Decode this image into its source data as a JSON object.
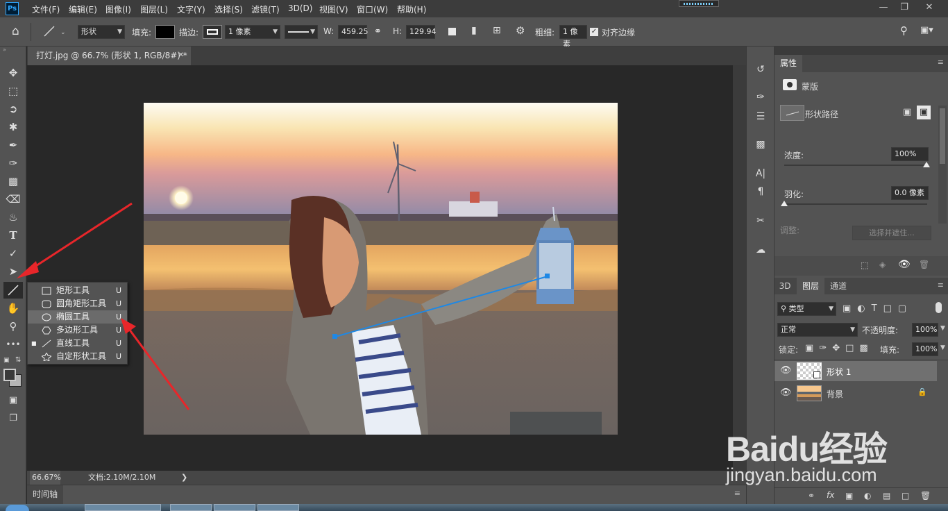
{
  "app": {
    "logo": "Ps"
  },
  "menu": [
    "文件(F)",
    "编辑(E)",
    "图像(I)",
    "图层(L)",
    "文字(Y)",
    "选择(S)",
    "滤镜(T)",
    "3D(D)",
    "视图(V)",
    "窗口(W)",
    "帮助(H)"
  ],
  "window_controls": [
    "minimize-icon",
    "restore-icon",
    "close-icon"
  ],
  "options": {
    "mode": "形状",
    "fill_label": "填充:",
    "stroke_label": "描边:",
    "stroke_width": "1 像素",
    "w_label": "W:",
    "w_value": "459.25",
    "h_label": "H:",
    "h_value": "129.94",
    "weight_label": "粗细:",
    "weight_value": "1 像素",
    "align_edges": "对齐边缘",
    "fill_color": "#000000"
  },
  "document": {
    "tab_title": "打灯.jpg @ 66.7% (形状 1, RGB/8#) *",
    "zoom": "66.67%",
    "doc_size": "文档:2.10M/2.10M"
  },
  "timeline": {
    "label": "时间轴"
  },
  "flyout": [
    {
      "label": "矩形工具",
      "key": "U",
      "icon": "rectangle-icon",
      "selected": false,
      "current": false
    },
    {
      "label": "圆角矩形工具",
      "key": "U",
      "icon": "rounded-rectangle-icon",
      "selected": false,
      "current": false
    },
    {
      "label": "椭圆工具",
      "key": "U",
      "icon": "ellipse-icon",
      "selected": true,
      "current": false
    },
    {
      "label": "多边形工具",
      "key": "U",
      "icon": "polygon-icon",
      "selected": false,
      "current": false
    },
    {
      "label": "直线工具",
      "key": "U",
      "icon": "line-icon",
      "selected": false,
      "current": true
    },
    {
      "label": "自定形状工具",
      "key": "U",
      "icon": "custom-shape-icon",
      "selected": false,
      "current": false
    }
  ],
  "properties": {
    "tab": "属性",
    "mask_label": "蒙版",
    "shape_path_label": "形状路径",
    "density_label": "浓度:",
    "density_value": "100%",
    "feather_label": "羽化:",
    "feather_value": "0.0 像素",
    "adjust_label": "调整:",
    "select_mask_button": "选择并遮住..."
  },
  "layers_panel": {
    "tabs": [
      "3D",
      "图层",
      "通道"
    ],
    "filter_kind": "类型",
    "blend_mode": "正常",
    "opacity_label": "不透明度:",
    "opacity_value": "100%",
    "lock_label": "锁定:",
    "fill_label": "填充:",
    "fill_value": "100%",
    "layers": [
      {
        "name": "形状 1",
        "selected": true
      },
      {
        "name": "背景",
        "selected": false,
        "locked": true
      }
    ]
  },
  "watermark": {
    "brand": "Baidu经验",
    "url": "jingyan.baidu.com"
  },
  "colors": {
    "accent": "#31a8ff",
    "arrow_red": "#e8262a",
    "line_blue": "#1e88e5"
  }
}
